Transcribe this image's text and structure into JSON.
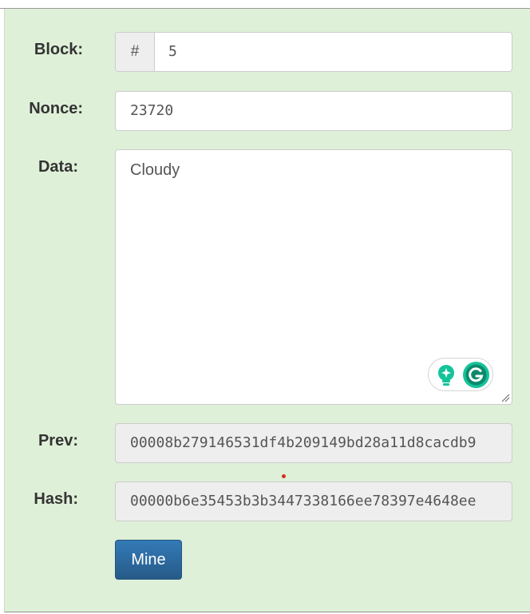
{
  "block": {
    "label": "Block:",
    "addon": "#",
    "value": "5"
  },
  "nonce": {
    "label": "Nonce:",
    "value": "23720"
  },
  "data": {
    "label": "Data:",
    "value": "Cloudy"
  },
  "prev": {
    "label": "Prev:",
    "value": "00008b279146531df4b209149bd28a11d8cacdb9"
  },
  "hash": {
    "label": "Hash:",
    "value": "00000b6e35453b3b3447338166ee78397e4648ee"
  },
  "actions": {
    "mine_label": "Mine"
  },
  "grammarly": {
    "bulb_icon": "lightbulb-icon",
    "logo_icon": "grammarly-g-icon",
    "color": "#15c39a"
  },
  "colors": {
    "panel_bg": "#dff0d8",
    "button_bg": "#2e6da4"
  }
}
